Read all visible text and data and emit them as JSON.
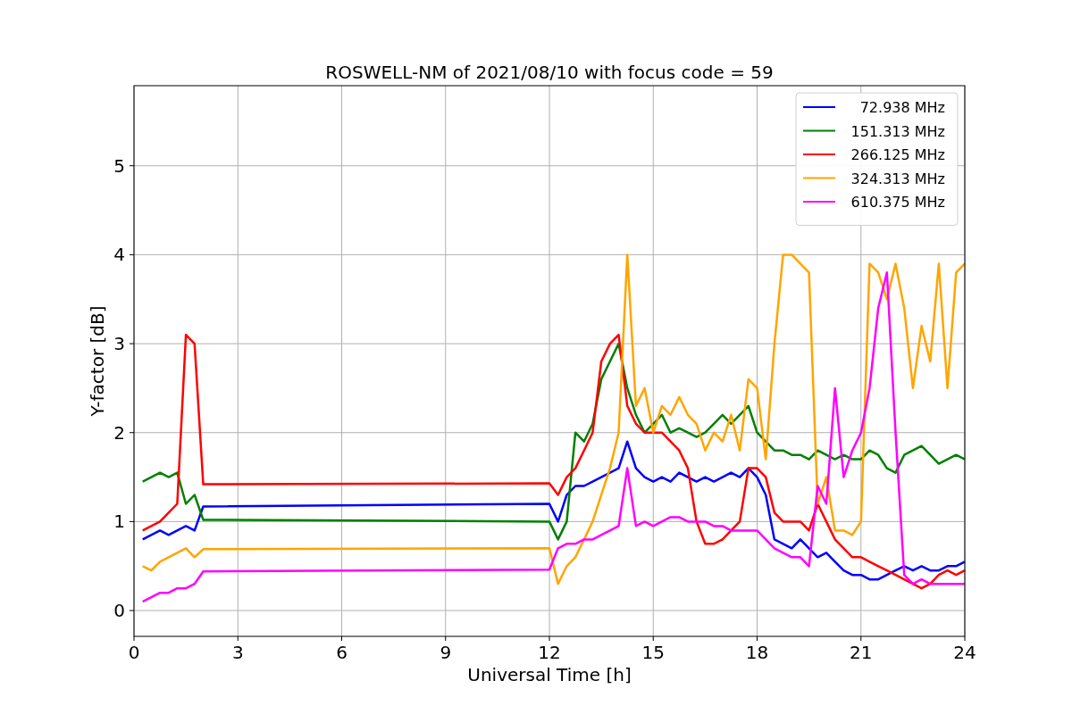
{
  "figure": {
    "chart_data": {
      "type": "line",
      "title": "ROSWELL-NM of 2021/08/10 with focus code = 59",
      "xlabel": "Universal Time [h]",
      "ylabel": "Y-factor [dB]",
      "x": [
        0.25,
        0.5,
        0.75,
        1.0,
        1.25,
        1.5,
        1.75,
        2.0,
        12.0,
        12.25,
        12.5,
        12.75,
        13.0,
        13.25,
        13.5,
        13.75,
        14.0,
        14.25,
        14.5,
        14.75,
        15.0,
        15.25,
        15.5,
        15.75,
        16.0,
        16.25,
        16.5,
        16.75,
        17.0,
        17.25,
        17.5,
        17.75,
        18.0,
        18.25,
        18.5,
        18.75,
        19.0,
        19.25,
        19.5,
        19.75,
        20.0,
        20.25,
        20.5,
        20.75,
        21.0,
        21.25,
        21.5,
        21.75,
        22.0,
        22.25,
        22.5,
        22.75,
        23.0,
        23.25,
        23.5,
        23.75,
        24.0
      ],
      "series": [
        {
          "name": "72.938 MHz",
          "color": "#0000ff",
          "values": [
            0.8,
            0.85,
            0.9,
            0.85,
            0.9,
            0.95,
            0.9,
            1.17,
            1.2,
            1.0,
            1.3,
            1.4,
            1.4,
            1.45,
            1.5,
            1.55,
            1.6,
            1.9,
            1.6,
            1.5,
            1.45,
            1.5,
            1.45,
            1.55,
            1.5,
            1.45,
            1.5,
            1.45,
            1.5,
            1.55,
            1.5,
            1.6,
            1.5,
            1.3,
            0.8,
            0.75,
            0.7,
            0.8,
            0.7,
            0.6,
            0.65,
            0.55,
            0.45,
            0.4,
            0.4,
            0.35,
            0.35,
            0.4,
            0.45,
            0.5,
            0.45,
            0.5,
            0.45,
            0.45,
            0.5,
            0.5,
            0.55
          ]
        },
        {
          "name": "151.313 MHz",
          "color": "#008000",
          "values": [
            1.45,
            1.5,
            1.55,
            1.5,
            1.55,
            1.2,
            1.3,
            1.02,
            1.0,
            0.8,
            1.0,
            2.0,
            1.9,
            2.1,
            2.6,
            2.8,
            3.0,
            2.5,
            2.2,
            2.0,
            2.1,
            2.2,
            2.0,
            2.05,
            2.0,
            1.95,
            2.0,
            2.1,
            2.2,
            2.1,
            2.2,
            2.3,
            2.0,
            1.9,
            1.8,
            1.8,
            1.75,
            1.75,
            1.7,
            1.8,
            1.75,
            1.7,
            1.75,
            1.7,
            1.7,
            1.8,
            1.75,
            1.6,
            1.55,
            1.75,
            1.8,
            1.85,
            1.75,
            1.65,
            1.7,
            1.75,
            1.7
          ]
        },
        {
          "name": "266.125 MHz",
          "color": "#ff0000",
          "values": [
            0.9,
            0.95,
            1.0,
            1.1,
            1.2,
            3.1,
            3.0,
            1.42,
            1.43,
            1.3,
            1.5,
            1.6,
            1.8,
            2.0,
            2.8,
            3.0,
            3.1,
            2.3,
            2.1,
            2.0,
            2.0,
            2.0,
            1.9,
            1.8,
            1.6,
            1.0,
            0.75,
            0.75,
            0.8,
            0.9,
            1.0,
            1.6,
            1.6,
            1.5,
            1.1,
            1.0,
            1.0,
            1.0,
            0.9,
            1.2,
            1.0,
            0.8,
            0.7,
            0.6,
            0.6,
            0.55,
            0.5,
            0.45,
            0.4,
            0.35,
            0.3,
            0.25,
            0.3,
            0.4,
            0.45,
            0.4,
            0.45
          ]
        },
        {
          "name": "324.313 MHz",
          "color": "#ffa500",
          "values": [
            0.5,
            0.45,
            0.55,
            0.6,
            0.65,
            0.7,
            0.6,
            0.69,
            0.7,
            0.3,
            0.5,
            0.6,
            0.8,
            1.0,
            1.3,
            1.6,
            2.0,
            4.0,
            2.3,
            2.5,
            2.0,
            2.3,
            2.2,
            2.4,
            2.2,
            2.1,
            1.8,
            2.0,
            1.9,
            2.2,
            1.8,
            2.6,
            2.5,
            1.7,
            3.0,
            4.0,
            4.0,
            3.9,
            3.8,
            1.2,
            1.5,
            0.9,
            0.9,
            0.85,
            1.0,
            3.9,
            3.8,
            3.5,
            3.9,
            3.4,
            2.5,
            3.2,
            2.8,
            3.9,
            2.5,
            3.8,
            3.9
          ]
        },
        {
          "name": "610.375 MHz",
          "color": "#ff00ff",
          "values": [
            0.1,
            0.15,
            0.2,
            0.2,
            0.25,
            0.25,
            0.3,
            0.44,
            0.46,
            0.7,
            0.75,
            0.75,
            0.8,
            0.8,
            0.85,
            0.9,
            0.95,
            1.6,
            0.95,
            1.0,
            0.95,
            1.0,
            1.05,
            1.05,
            1.0,
            1.0,
            1.0,
            0.95,
            0.95,
            0.9,
            0.9,
            0.9,
            0.9,
            0.8,
            0.7,
            0.65,
            0.6,
            0.6,
            0.5,
            1.4,
            1.2,
            2.5,
            1.5,
            1.8,
            2.0,
            2.5,
            3.4,
            3.8,
            2.0,
            0.4,
            0.3,
            0.35,
            0.3,
            0.3,
            0.3,
            0.3,
            0.3
          ]
        }
      ],
      "grid": true,
      "legend": true,
      "xlim": [
        0,
        24
      ],
      "ylim": [
        -0.29,
        5.9
      ],
      "xticks": [
        0,
        3,
        6,
        9,
        12,
        15,
        18,
        21,
        24
      ],
      "yticks": [
        0,
        1,
        2,
        3,
        4,
        5
      ]
    }
  }
}
